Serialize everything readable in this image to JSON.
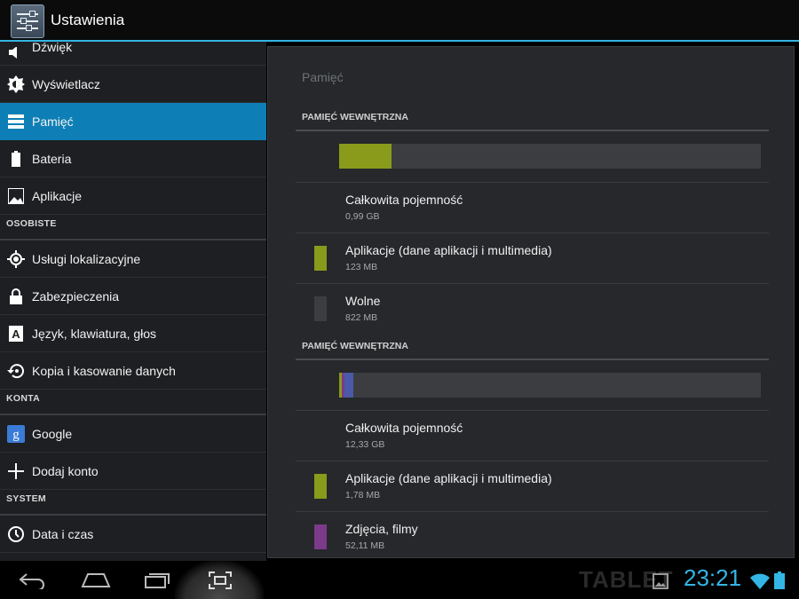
{
  "app": {
    "title": "Ustawienia"
  },
  "sidebar": {
    "items_top": [
      {
        "label": "Dźwięk",
        "icon": "sound-icon",
        "partial": true
      },
      {
        "label": "Wyświetlacz",
        "icon": "brightness-icon"
      },
      {
        "label": "Pamięć",
        "icon": "storage-icon",
        "active": true
      },
      {
        "label": "Bateria",
        "icon": "battery-icon"
      },
      {
        "label": "Aplikacje",
        "icon": "apps-icon"
      }
    ],
    "header_personal": "OSOBISTE",
    "items_personal": [
      {
        "label": "Usługi lokalizacyjne",
        "icon": "location-icon"
      },
      {
        "label": "Zabezpieczenia",
        "icon": "lock-icon"
      },
      {
        "label": "Język, klawiatura, głos",
        "icon": "language-icon"
      },
      {
        "label": "Kopia i kasowanie danych",
        "icon": "backup-icon"
      }
    ],
    "header_accounts": "KONTA",
    "items_accounts": [
      {
        "label": "Google",
        "icon": "google-icon"
      },
      {
        "label": "Dodaj konto",
        "icon": "add-icon"
      }
    ],
    "header_system": "SYSTEM",
    "items_system": [
      {
        "label": "Data i czas",
        "icon": "clock-icon"
      }
    ]
  },
  "panel": {
    "title": "Pamięć",
    "internal": {
      "header": "PAMIĘĆ WEWNĘTRZNA",
      "usage_fractions": {
        "apps": 0.124,
        "free": 0.876
      },
      "total_label": "Całkowita pojemność",
      "total_value": "0,99 GB",
      "apps_label": "Aplikacje (dane aplikacji i multimedia)",
      "apps_value": "123 MB",
      "free_label": "Wolne",
      "free_value": "822 MB"
    },
    "internal2": {
      "header": "PAMIĘĆ WEWNĘTRZNA",
      "usage_fractions": {
        "apps": 0.007,
        "other": 0.006,
        "media": 0.021
      },
      "total_label": "Całkowita pojemność",
      "total_value": "12,33 GB",
      "apps_label": "Aplikacje (dane aplikacji i multimedia)",
      "apps_value": "1,78 MB",
      "media_label": "Zdjęcia, filmy",
      "media_value": "52,11 MB"
    }
  },
  "colors": {
    "accent": "#33b5e5",
    "active_item": "#0e7fb6",
    "apps_segment": "#8a9a1b",
    "free_segment": "#3b3d40",
    "media_segment": "#7b3b8a",
    "other_segment": "#4a5aa8"
  },
  "statusbar": {
    "time": "23:21",
    "watermark": "TABLET"
  }
}
